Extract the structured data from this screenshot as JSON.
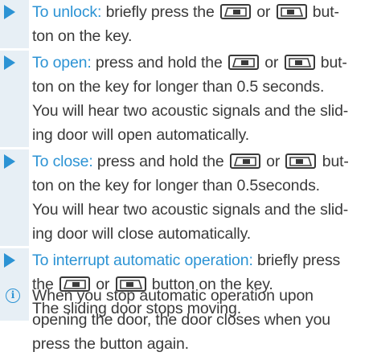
{
  "instructions": [
    {
      "lead": "To unlock:",
      "part1": " briefly press the ",
      "or_word": " or ",
      "part2": " but-",
      "rest_lines": [
        "ton on the key."
      ],
      "icon_left": "sliding-door-left-key-icon",
      "icon_right": "sliding-door-right-key-icon"
    },
    {
      "lead": "To open:",
      "part1": " press and hold the ",
      "or_word": " or ",
      "part2": " but-",
      "rest_lines": [
        "ton on the key for longer than 0.5 seconds.",
        "You will hear two acoustic signals and the slid-",
        "ing door will open automatically."
      ],
      "icon_left": "sliding-door-left-key-icon",
      "icon_right": "sliding-door-right-key-icon"
    },
    {
      "lead": "To close:",
      "part1": " press and hold the ",
      "or_word": " or ",
      "part2": " but-",
      "rest_lines": [
        "ton on the key for longer than 0.5seconds.",
        "You will hear two acoustic signals and the slid-",
        "ing door will close automatically."
      ],
      "icon_left": "sliding-door-left-key-icon",
      "icon_right": "sliding-door-right-key-icon"
    },
    {
      "lead": "To interrupt automatic operation:",
      "part1": " briefly press",
      "line2_pre": "the ",
      "or_word": " or ",
      "part2": " button on the key.",
      "rest_lines": [
        "The sliding door stops moving."
      ],
      "icon_left": "sliding-door-left-key-icon",
      "icon_right": "sliding-door-right-key-icon"
    }
  ],
  "note": {
    "icon": "info-icon",
    "icon_glyph": "i",
    "lines": [
      "When you stop automatic operation upon",
      "opening the door, the door closes when you",
      "press the button again."
    ]
  },
  "colors": {
    "accent": "#2c93d4",
    "bar": "#e7eff5",
    "text": "#3a3a3a"
  }
}
